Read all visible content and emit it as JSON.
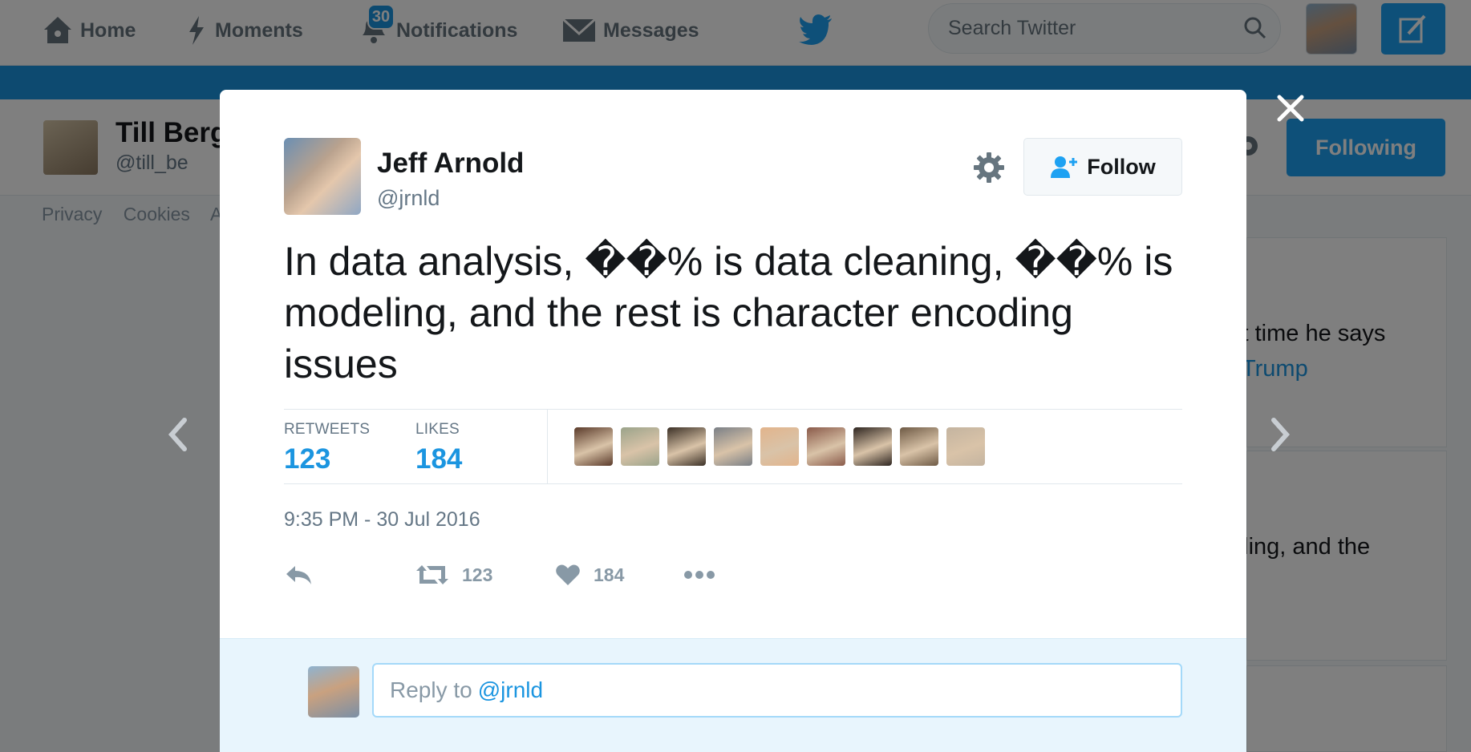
{
  "nav": {
    "home": "Home",
    "moments": "Moments",
    "notifications": "Notifications",
    "notifications_count": "30",
    "messages": "Messages",
    "search_placeholder": "Search Twitter"
  },
  "profile": {
    "name": "Till Berg",
    "handle": "@till_be",
    "following_label": "Following",
    "footer_links": [
      "Privacy",
      "Cookies",
      "A"
    ]
  },
  "background_tweets": {
    "text_1": "st time he says",
    "link_1": "Trump",
    "text_2": "eling, and the"
  },
  "tweet": {
    "author_name": "Jeff Arnold",
    "author_handle": "@jrnld",
    "follow_label": "Follow",
    "text": "In data analysis, ��% is data cleaning, ��% is modeling, and the rest is character encoding issues",
    "retweets_label": "RETWEETS",
    "retweets_count": "123",
    "likes_label": "LIKES",
    "likes_count": "184",
    "timestamp": "9:35 PM - 30 Jul 2016",
    "action_retweet_count": "123",
    "action_like_count": "184",
    "liker_colors": [
      "#5a3a2a",
      "#9aa38a",
      "#3b3026",
      "#7a7f86",
      "#e2b48c",
      "#8a5a4a",
      "#2e2520",
      "#6e5a45",
      "#c4b4a0"
    ]
  },
  "reply": {
    "prefix": "Reply to",
    "mention": "@jrnld"
  },
  "colors": {
    "brand_blue": "#1da1f2",
    "link_blue": "#1b95e0"
  }
}
